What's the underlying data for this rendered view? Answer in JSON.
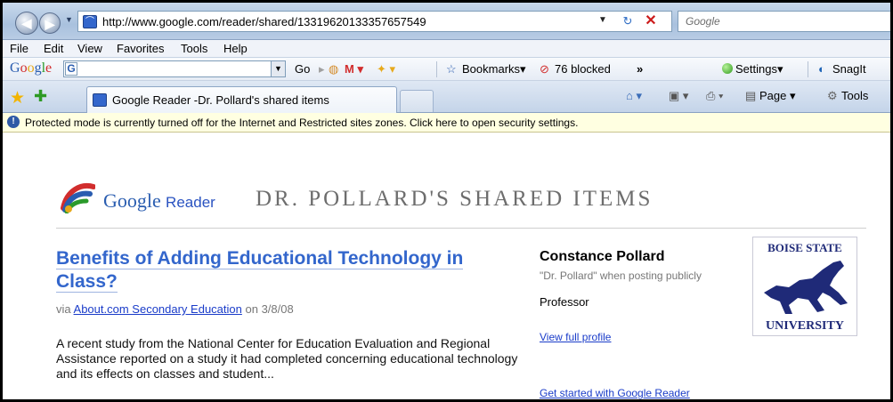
{
  "browser": {
    "url": "http://www.google.com/reader/shared/13319620133357657549",
    "search_placeholder": "Google",
    "menu": [
      "File",
      "Edit",
      "View",
      "Favorites",
      "Tools",
      "Help"
    ],
    "google_toolbar": {
      "logo": "Google",
      "go_label": "Go",
      "bookmarks_label": "Bookmarks▾",
      "blocked_label": "76 blocked",
      "more_label": "»",
      "settings_label": "Settings▾",
      "snagit_label": "SnagIt"
    },
    "tab_title": "Google Reader -Dr. Pollard's shared items",
    "commands": {
      "page_label": "Page ▾",
      "tools_label": "Tools"
    },
    "info_bar": "Protected mode is currently turned off for the Internet and Restricted sites zones.  Click here to open security settings."
  },
  "page": {
    "logo_google": "Google",
    "logo_reader": "Reader",
    "title": "DR. POLLARD'S SHARED ITEMS",
    "post": {
      "title": "Benefits of Adding Educational Technology in Class?",
      "via_prefix": "via",
      "source": "About.com Secondary Education",
      "date_text": "on 3/8/08",
      "body": "A recent study from the National Center for Education Evaluation and Regional Assistance reported on a study it had completed concerning educational technology and its effects on classes and student..."
    },
    "profile": {
      "name": "Constance Pollard",
      "alias": "\"Dr. Pollard\" when posting publicly",
      "role": "Professor",
      "view_profile": "View full profile",
      "get_started": "Get started with Google Reader"
    },
    "bsu_logo": {
      "top": "BOISE STATE",
      "bottom": "UNIVERSITY"
    }
  }
}
